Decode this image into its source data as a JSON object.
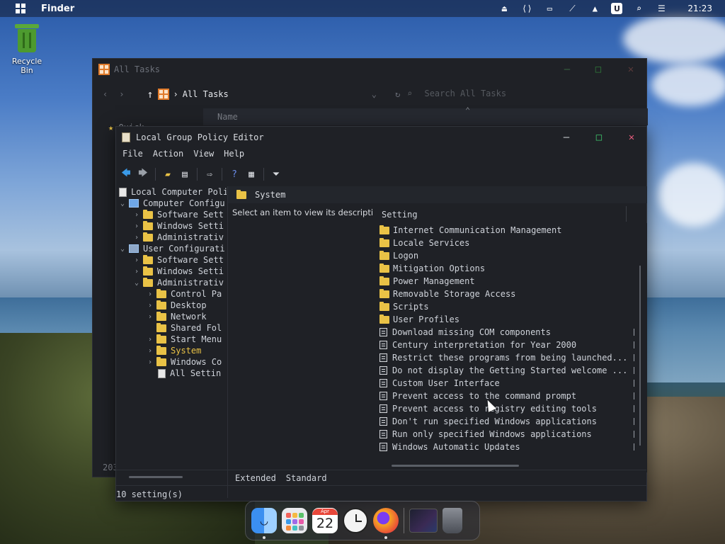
{
  "topbar": {
    "app_name": "Finder",
    "badge_label": "U",
    "clock": "21:23",
    "tray_icons": [
      "eject-icon",
      "remote-desktop-icon",
      "display-icon",
      "network-off-icon",
      "upload-icon",
      "user-badge-icon",
      "search-icon",
      "control-center-icon"
    ]
  },
  "desktop": {
    "recycle_bin_label": "Recycle Bin"
  },
  "all_tasks": {
    "title": "All Tasks",
    "path": "All Tasks",
    "search_placeholder": "Search All Tasks",
    "column_name": "Name",
    "side_item": "Quick",
    "status_partial": "203"
  },
  "gpe": {
    "title": "Local Group Policy Editor",
    "menu": [
      "File",
      "Action",
      "View",
      "Help"
    ],
    "tree": [
      {
        "label": "Local Computer Poli",
        "level": 0,
        "chev": "",
        "icon": "doc"
      },
      {
        "label": "Computer Configu",
        "level": 0,
        "chev": "v",
        "icon": "pc"
      },
      {
        "label": "Software Sett",
        "level": 1,
        "chev": ">",
        "icon": "folder"
      },
      {
        "label": "Windows Setti",
        "level": 1,
        "chev": ">",
        "icon": "folder"
      },
      {
        "label": "Administrativ",
        "level": 1,
        "chev": ">",
        "icon": "folder"
      },
      {
        "label": "User Configurati",
        "level": 0,
        "chev": "v",
        "icon": "user"
      },
      {
        "label": "Software Sett",
        "level": 1,
        "chev": ">",
        "icon": "folder"
      },
      {
        "label": "Windows Setti",
        "level": 1,
        "chev": ">",
        "icon": "folder"
      },
      {
        "label": "Administrativ",
        "level": 1,
        "chev": "v",
        "icon": "folder"
      },
      {
        "label": "Control Pa",
        "level": 2,
        "chev": ">",
        "icon": "folder"
      },
      {
        "label": "Desktop",
        "level": 2,
        "chev": ">",
        "icon": "folder"
      },
      {
        "label": "Network",
        "level": 2,
        "chev": ">",
        "icon": "folder"
      },
      {
        "label": "Shared Fol",
        "level": 2,
        "chev": "",
        "icon": "folder"
      },
      {
        "label": "Start Menu",
        "level": 2,
        "chev": ">",
        "icon": "folder"
      },
      {
        "label": "System",
        "level": 2,
        "chev": ">",
        "icon": "folder",
        "selected": true
      },
      {
        "label": "Windows Co",
        "level": 2,
        "chev": ">",
        "icon": "folder"
      },
      {
        "label": "All Settin",
        "level": 2,
        "chev": "",
        "icon": "doc"
      }
    ],
    "pane_header": "System",
    "description": "Select an item to view its description.",
    "column_setting": "Setting",
    "settings": [
      {
        "label": "Internet Communication Management",
        "type": "folder"
      },
      {
        "label": "Locale Services",
        "type": "folder"
      },
      {
        "label": "Logon",
        "type": "folder"
      },
      {
        "label": "Mitigation Options",
        "type": "folder"
      },
      {
        "label": "Power Management",
        "type": "folder"
      },
      {
        "label": "Removable Storage Access",
        "type": "folder"
      },
      {
        "label": "Scripts",
        "type": "folder"
      },
      {
        "label": "User Profiles",
        "type": "folder"
      },
      {
        "label": "Download missing COM components",
        "type": "policy"
      },
      {
        "label": "Century interpretation for Year 2000",
        "type": "policy"
      },
      {
        "label": "Restrict these programs from being launched...",
        "type": "policy"
      },
      {
        "label": "Do not display the Getting Started welcome ...",
        "type": "policy"
      },
      {
        "label": "Custom User Interface",
        "type": "policy"
      },
      {
        "label": "Prevent access to the command prompt",
        "type": "policy"
      },
      {
        "label": "Prevent access to registry editing tools",
        "type": "policy"
      },
      {
        "label": "Don't run specified Windows applications",
        "type": "policy"
      },
      {
        "label": "Run only specified Windows applications",
        "type": "policy"
      },
      {
        "label": "Windows Automatic Updates",
        "type": "policy"
      }
    ],
    "tabs": [
      "Extended",
      "Standard"
    ],
    "status": "10 setting(s)"
  },
  "dock": {
    "calendar_month": "Apr",
    "calendar_day": "22"
  }
}
